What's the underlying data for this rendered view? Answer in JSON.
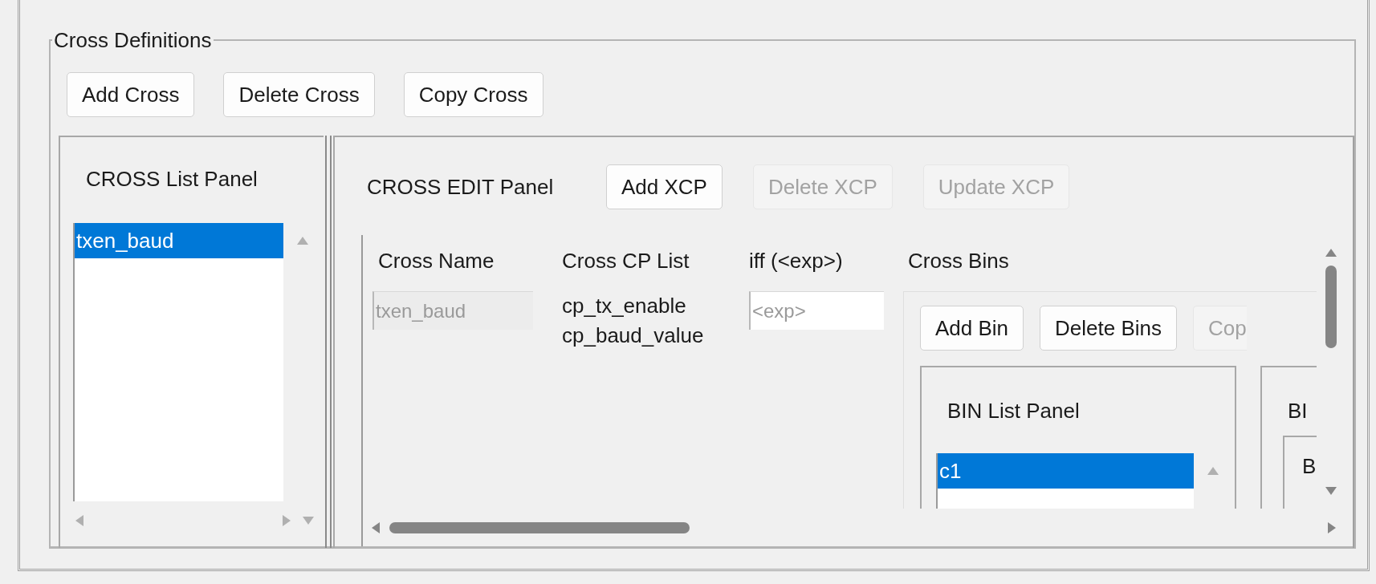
{
  "group": {
    "title": "Cross Definitions"
  },
  "toolbar": [
    {
      "label": "Add Cross",
      "disabled": false
    },
    {
      "label": "Delete Cross",
      "disabled": false
    },
    {
      "label": "Copy Cross",
      "disabled": false
    }
  ],
  "cross_list_panel": {
    "title": "CROSS List Panel",
    "items": [
      {
        "label": "txen_baud",
        "selected": true
      }
    ]
  },
  "cross_edit_panel": {
    "title": "CROSS EDIT Panel",
    "buttons": [
      {
        "label": "Add XCP",
        "disabled": false
      },
      {
        "label": "Delete XCP",
        "disabled": true
      },
      {
        "label": "Update XCP",
        "disabled": true
      }
    ],
    "columns": [
      "Cross Name",
      "Cross CP List",
      "iff (<exp>)",
      "Cross Bins"
    ],
    "cross_name": {
      "value": "txen_baud",
      "disabled": true
    },
    "cp_list": [
      "cp_tx_enable",
      "cp_baud_value"
    ],
    "iff": {
      "placeholder": "<exp>"
    },
    "bins": {
      "buttons": [
        {
          "label": "Add Bin",
          "disabled": false
        },
        {
          "label": "Delete Bins",
          "disabled": false
        },
        {
          "label": "Cop",
          "disabled": true
        }
      ],
      "bin_list_panel": {
        "title": "BIN List Panel",
        "items": [
          {
            "label": "c1",
            "selected": true
          }
        ]
      },
      "bin_panel": {
        "title": "BI",
        "field": "B"
      }
    }
  }
}
